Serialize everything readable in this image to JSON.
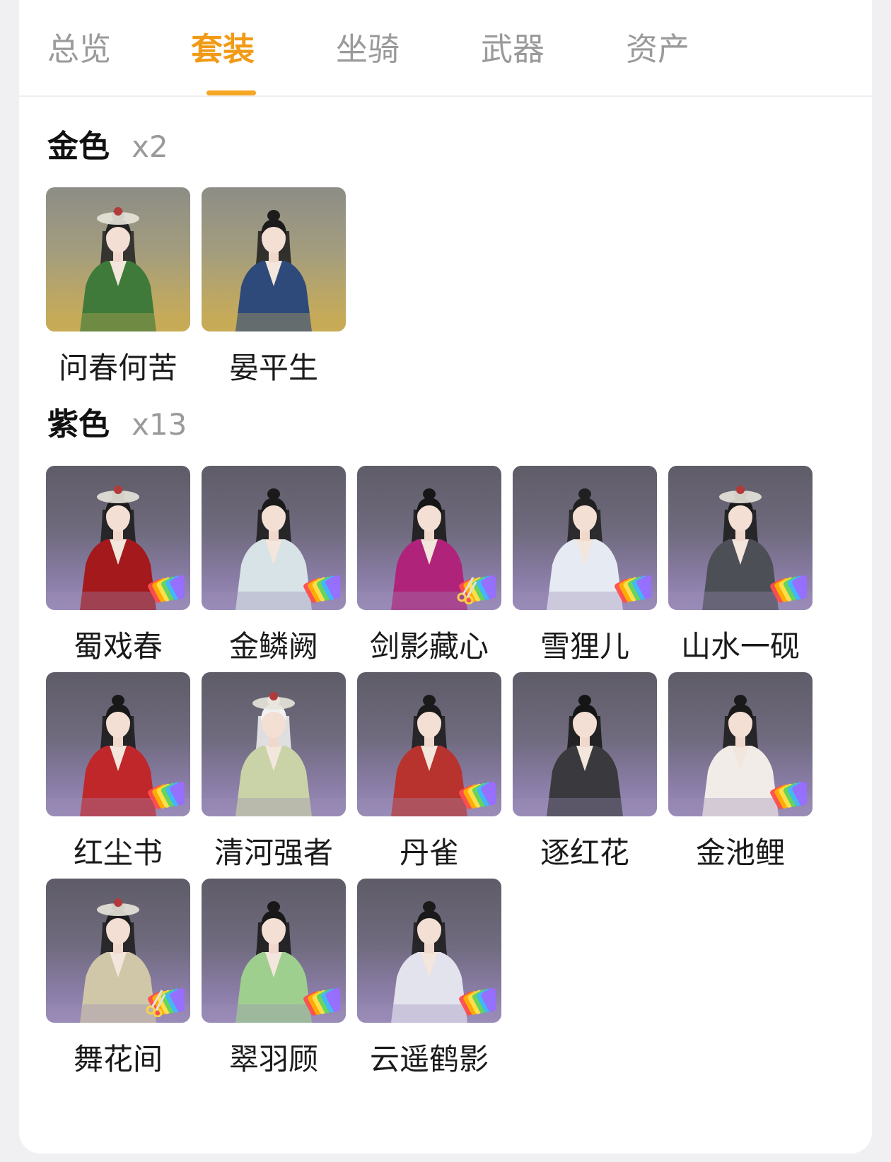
{
  "tabs": [
    {
      "label": "总览",
      "active": false
    },
    {
      "label": "套装",
      "active": true
    },
    {
      "label": "坐骑",
      "active": false
    },
    {
      "label": "武器",
      "active": false
    },
    {
      "label": "资产",
      "active": false
    }
  ],
  "sections": [
    {
      "title": "金色",
      "count": "x2",
      "rarity": "gold",
      "items": [
        {
          "name": "问春何苦",
          "outfit": "#3f7a3a",
          "hair": "#222222",
          "hat": true,
          "badge": "none"
        },
        {
          "name": "晏平生",
          "outfit": "#2e4a7a",
          "hair": "#1c1c1c",
          "hat": false,
          "badge": "none"
        }
      ]
    },
    {
      "title": "紫色",
      "count": "x13",
      "rarity": "purple",
      "items": [
        {
          "name": "蜀戏春",
          "outfit": "#a3191c",
          "hair": "#1a1a1a",
          "hat": true,
          "badge": "rainbow"
        },
        {
          "name": "金鳞阙",
          "outfit": "#d7e3e6",
          "hair": "#1a1a1a",
          "hat": false,
          "badge": "rainbow"
        },
        {
          "name": "剑影藏心",
          "outfit": "#b0237a",
          "hair": "#161616",
          "hat": false,
          "badge": "scissors"
        },
        {
          "name": "雪狸儿",
          "outfit": "#e6eaf2",
          "hair": "#202020",
          "hat": false,
          "badge": "rainbow"
        },
        {
          "name": "山水一砚",
          "outfit": "#4d4f57",
          "hair": "#1a1a1a",
          "hat": true,
          "badge": "rainbow"
        },
        {
          "name": "红尘书",
          "outfit": "#c0272a",
          "hair": "#181818",
          "hat": false,
          "badge": "rainbow"
        },
        {
          "name": "清河强者",
          "outfit": "#c9d3a7",
          "hair": "#f2f2f2",
          "hat": true,
          "badge": "none"
        },
        {
          "name": "丹雀",
          "outfit": "#b8332d",
          "hair": "#1a1a1a",
          "hat": false,
          "badge": "rainbow"
        },
        {
          "name": "逐红花",
          "outfit": "#3a3a3e",
          "hair": "#151515",
          "hat": false,
          "badge": "none"
        },
        {
          "name": "金池鲤",
          "outfit": "#f1ece7",
          "hair": "#1a1a1a",
          "hat": false,
          "badge": "rainbow"
        },
        {
          "name": "舞花间",
          "outfit": "#cfc7a8",
          "hair": "#1c1c1c",
          "hat": true,
          "badge": "scissors"
        },
        {
          "name": "翠羽顾",
          "outfit": "#9fcf8f",
          "hair": "#181818",
          "hat": false,
          "badge": "rainbow"
        },
        {
          "name": "云遥鹤影",
          "outfit": "#e3e3ee",
          "hair": "#1a1a1a",
          "hat": false,
          "badge": "rainbow"
        }
      ]
    }
  ],
  "colors": {
    "accent": "#f19a16",
    "underline": "#f5a623",
    "inactive_tab": "#9a9a9a"
  }
}
